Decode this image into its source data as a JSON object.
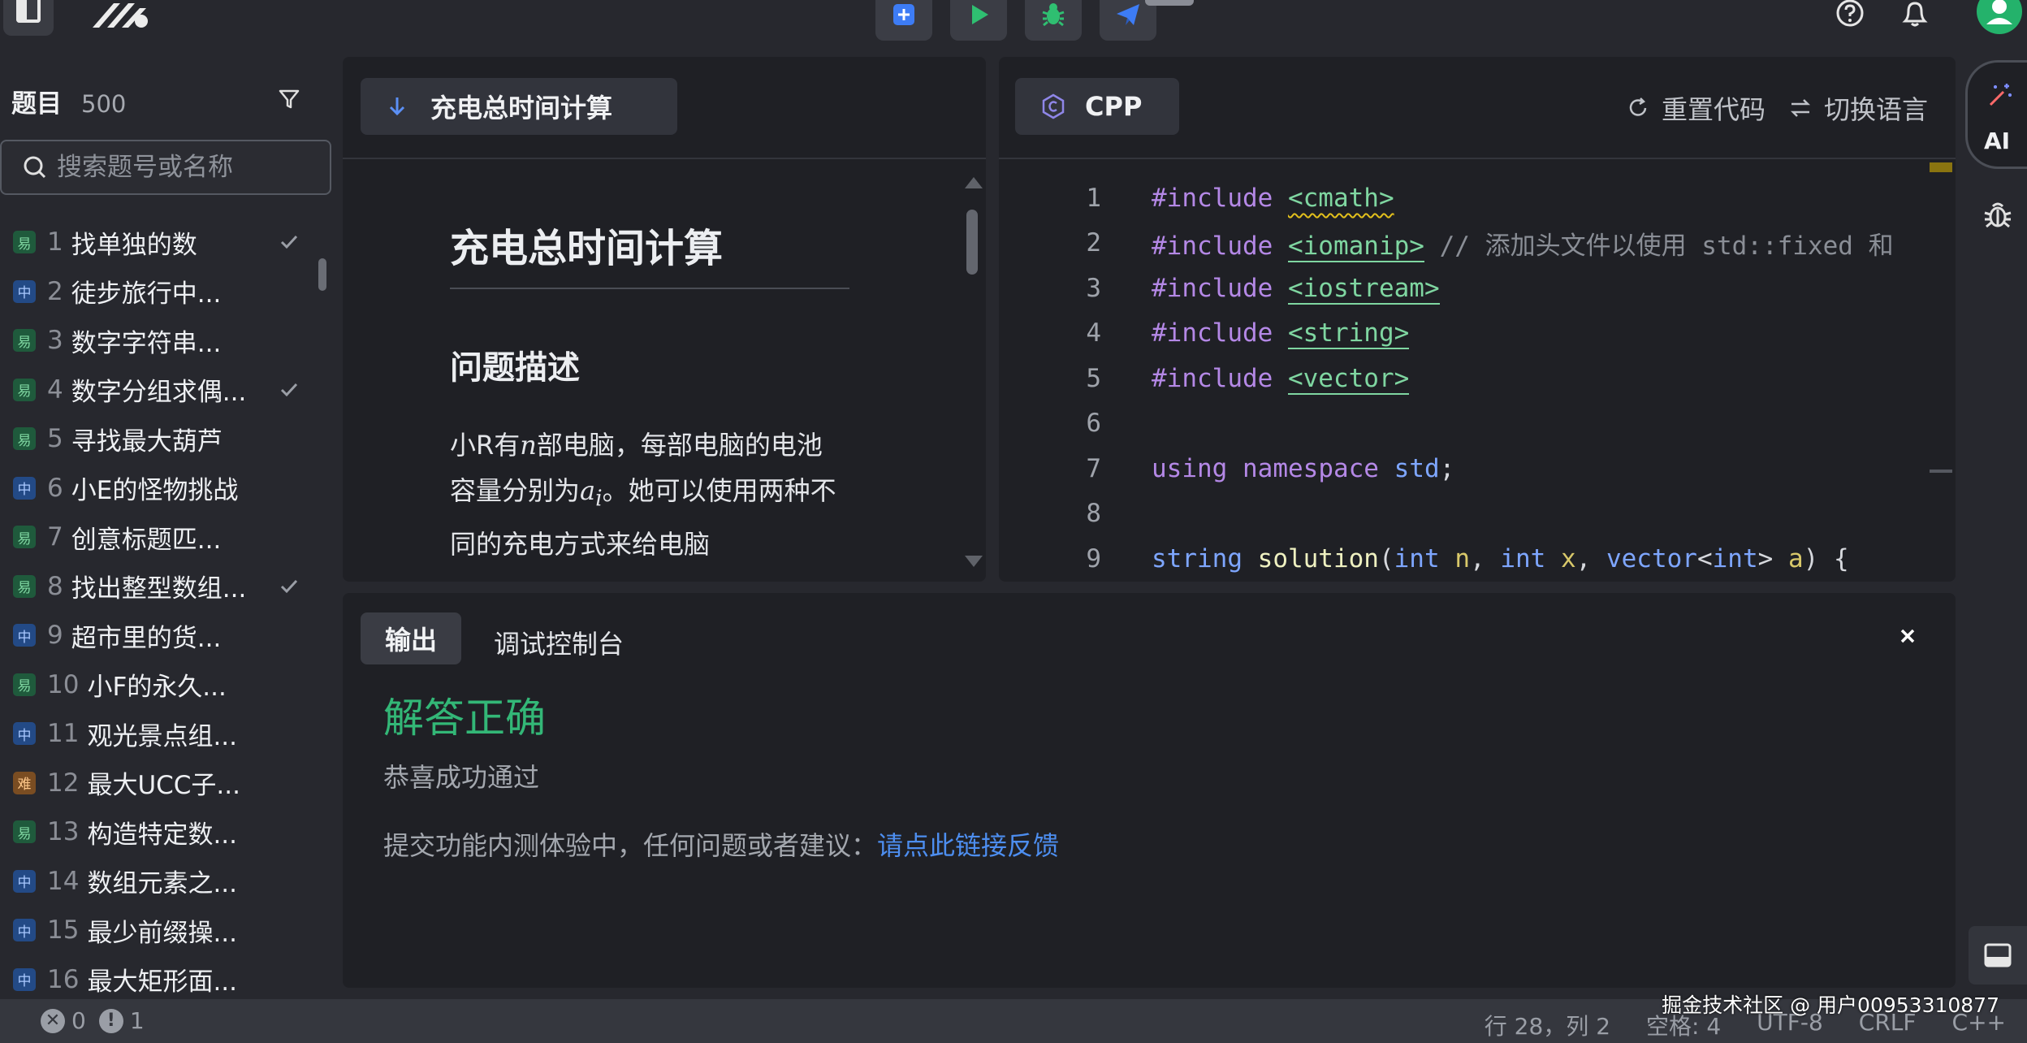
{
  "sidebar": {
    "title": "题目",
    "count": "500",
    "search_placeholder": "搜索题号或名称",
    "items": [
      {
        "difficulty": "易",
        "level": "easy",
        "num": "1",
        "name": "找单独的数",
        "done": true
      },
      {
        "difficulty": "中",
        "level": "mid",
        "num": "2",
        "name": "徒步旅行中...",
        "done": false
      },
      {
        "difficulty": "易",
        "level": "easy",
        "num": "3",
        "name": "数字字符串...",
        "done": false
      },
      {
        "difficulty": "易",
        "level": "easy",
        "num": "4",
        "name": "数字分组求偶...",
        "done": true
      },
      {
        "difficulty": "易",
        "level": "easy",
        "num": "5",
        "name": "寻找最大葫芦",
        "done": false
      },
      {
        "difficulty": "中",
        "level": "mid",
        "num": "6",
        "name": "小E的怪物挑战",
        "done": false
      },
      {
        "difficulty": "易",
        "level": "easy",
        "num": "7",
        "name": "创意标题匹...",
        "done": false
      },
      {
        "difficulty": "易",
        "level": "easy",
        "num": "8",
        "name": "找出整型数组...",
        "done": true
      },
      {
        "difficulty": "中",
        "level": "mid",
        "num": "9",
        "name": "超市里的货...",
        "done": false
      },
      {
        "difficulty": "易",
        "level": "easy",
        "num": "10",
        "name": "小F的永久...",
        "done": false
      },
      {
        "difficulty": "中",
        "level": "mid",
        "num": "11",
        "name": "观光景点组...",
        "done": false
      },
      {
        "difficulty": "难",
        "level": "hard",
        "num": "12",
        "name": "最大UCC子...",
        "done": false
      },
      {
        "difficulty": "易",
        "level": "easy",
        "num": "13",
        "name": "构造特定数...",
        "done": false
      },
      {
        "difficulty": "中",
        "level": "mid",
        "num": "14",
        "name": "数组元素之...",
        "done": false
      },
      {
        "difficulty": "中",
        "level": "mid",
        "num": "15",
        "name": "最少前缀操...",
        "done": false
      },
      {
        "difficulty": "中",
        "level": "mid",
        "num": "16",
        "name": "最大矩形面...",
        "done": false
      }
    ]
  },
  "problem": {
    "tab_label": "充电总时间计算",
    "title": "充电总时间计算",
    "section": "问题描述",
    "para_1": "小R有",
    "var_n": "n",
    "para_2": "部电脑，每部电脑的电池容量分别为",
    "var_a": "a",
    "var_sub": "i",
    "para_3": "。她可以使用两种不同的充电方式来给电脑"
  },
  "editor": {
    "language": "CPP",
    "reset_label": "重置代码",
    "switch_label": "切换语言",
    "lines": [
      {
        "n": "1"
      },
      {
        "n": "2"
      },
      {
        "n": "3"
      },
      {
        "n": "4"
      },
      {
        "n": "5"
      },
      {
        "n": "6"
      },
      {
        "n": "7"
      },
      {
        "n": "8"
      },
      {
        "n": "9"
      }
    ],
    "code": {
      "l1_kw": "#include",
      "l1_hdr": "<cmath>",
      "l2_kw": "#include",
      "l2_hdr": "<iomanip>",
      "l2_cmt": "// 添加头文件以使用 std::fixed 和",
      "l3_kw": "#include",
      "l3_hdr": "<iostream>",
      "l4_kw": "#include",
      "l4_hdr": "<string>",
      "l5_kw": "#include",
      "l5_hdr": "<vector>",
      "l7_kw1": "using",
      "l7_kw2": "namespace",
      "l7_ns": "std",
      "l7_end": ";",
      "l9_t1": "string",
      "l9_fn": "solution",
      "l9_p1": "(",
      "l9_t2": "int",
      "l9_v1": "n",
      "l9_c1": ", ",
      "l9_t3": "int",
      "l9_v2": "x",
      "l9_c2": ", ",
      "l9_t4": "vector",
      "l9_lt": "<",
      "l9_t5": "int",
      "l9_gt": ">",
      "l9_v3": "a",
      "l9_end": ") {"
    }
  },
  "output": {
    "tab_output": "输出",
    "tab_console": "调试控制台",
    "result": "解答正确",
    "result_sub": "恭喜成功通过",
    "feedback_text": "提交功能内测体验中，任何问题或者建议：",
    "feedback_link": "请点此链接反馈"
  },
  "rail": {
    "ai_label": "AI"
  },
  "statusbar": {
    "errors": "0",
    "warnings": "1",
    "position": "行 28，列 2",
    "spaces": "空格: 4",
    "encoding": "UTF-8",
    "eol": "CRLF",
    "lang": "C++"
  },
  "watermark": "掘金技术社区 @ 用户00953310877",
  "colors": {
    "success": "#33b777",
    "link": "#4d8ef0",
    "keyword": "#b488e6",
    "type": "#7ea6ff",
    "header": "#7fd6a1"
  },
  "icons": {
    "toolbar": [
      "add-icon",
      "run-icon",
      "debug-icon",
      "submit-icon"
    ],
    "top_right": [
      "help-icon",
      "bell-icon",
      "avatar"
    ]
  }
}
